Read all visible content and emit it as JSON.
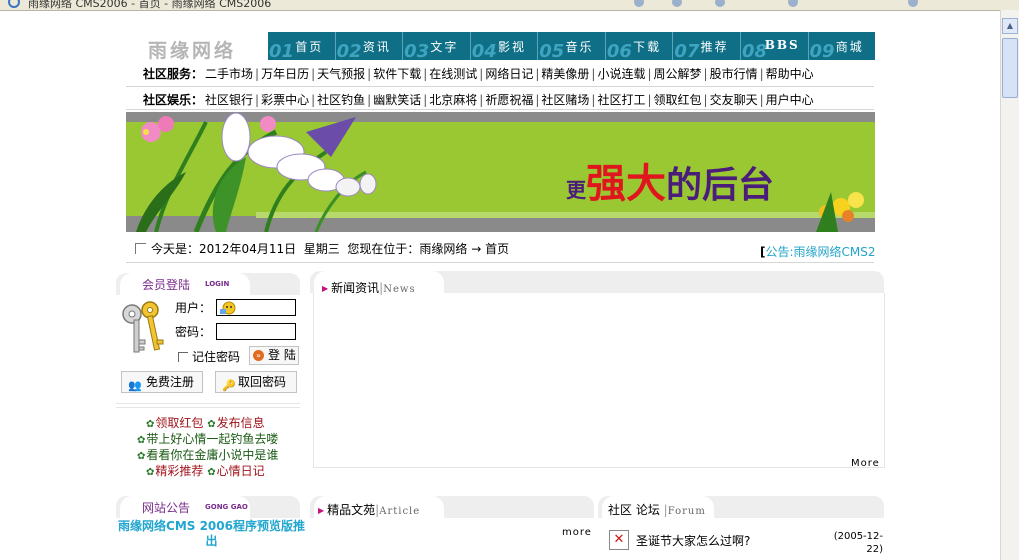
{
  "browser": {
    "tab_title": "雨缘网络 CMS2006 - 首页 - 雨缘网络 CMS2006"
  },
  "site": {
    "logo": "雨缘网络"
  },
  "nav": [
    {
      "num": "01",
      "label": "首页"
    },
    {
      "num": "02",
      "label": "资讯"
    },
    {
      "num": "03",
      "label": "文字"
    },
    {
      "num": "04",
      "label": "影视"
    },
    {
      "num": "05",
      "label": "音乐"
    },
    {
      "num": "06",
      "label": "下载"
    },
    {
      "num": "07",
      "label": "推荐"
    },
    {
      "num": "08",
      "label": "BBS"
    },
    {
      "num": "09",
      "label": "商城"
    }
  ],
  "services": {
    "label": "社区服务：",
    "items": [
      "二手市场",
      "万年日历",
      "天气预报",
      "软件下载",
      "在线测试",
      "网络日记",
      "精美像册",
      "小说连载",
      "周公解梦",
      "股市行情",
      "帮助中心"
    ]
  },
  "entertainment": {
    "label": "社区娱乐：",
    "items": [
      "社区银行",
      "彩票中心",
      "社区钓鱼",
      "幽默笑话",
      "北京麻将",
      "祈愿祝福",
      "社区赌场",
      "社区打工",
      "领取红包",
      "交友聊天",
      "用户中心"
    ]
  },
  "banner": {
    "slogan_1": "更",
    "slogan_2": "强",
    "slogan_3": "大",
    "slogan_4": "的后台"
  },
  "datebar": {
    "today_label": "今天是：",
    "date": "2012年04月11日",
    "weekday": "星期三",
    "location_label": "您现在位于：",
    "location_site": "雨缘网络",
    "location_arrow": "→",
    "location_page": "首页",
    "notice_label": "公告",
    "notice_text": "雨缘网络CMS2"
  },
  "login": {
    "title": "会员登陆",
    "title_en": "LOGIN",
    "user_label": "用户：",
    "password_label": "密码：",
    "remember_label": "记住密码",
    "submit_label": "登 陆",
    "register_label": "免费注册",
    "retrieve_label": "取回密码"
  },
  "quick_links": {
    "row1": [
      "领取红包",
      "发布信息"
    ],
    "row2": "带上好心情一起钓鱼去喽",
    "row3": "看看你在金庸小说中是谁",
    "row4": [
      "精彩推荐",
      "心情日记"
    ]
  },
  "news": {
    "title": "新闻资讯",
    "title_en": "News",
    "more": "More"
  },
  "articles": {
    "title": "精品文苑",
    "title_en": "Article",
    "more": "more"
  },
  "forum": {
    "title": "社区 论坛",
    "title_en": "Forum",
    "items": [
      {
        "title": "圣诞节大家怎么过啊?",
        "date": "(2005-12-22)"
      }
    ]
  },
  "site_notice": {
    "title": "网站公告",
    "title_en": "GONG GAO",
    "text": "雨缘网络CMS 2006程序预览版推出"
  },
  "colors": {
    "nav_bg": "#0f6f86",
    "banner_green": "#9ac833",
    "notice_cyan": "#21a6cf",
    "panel_purple": "#7a2c8c"
  }
}
